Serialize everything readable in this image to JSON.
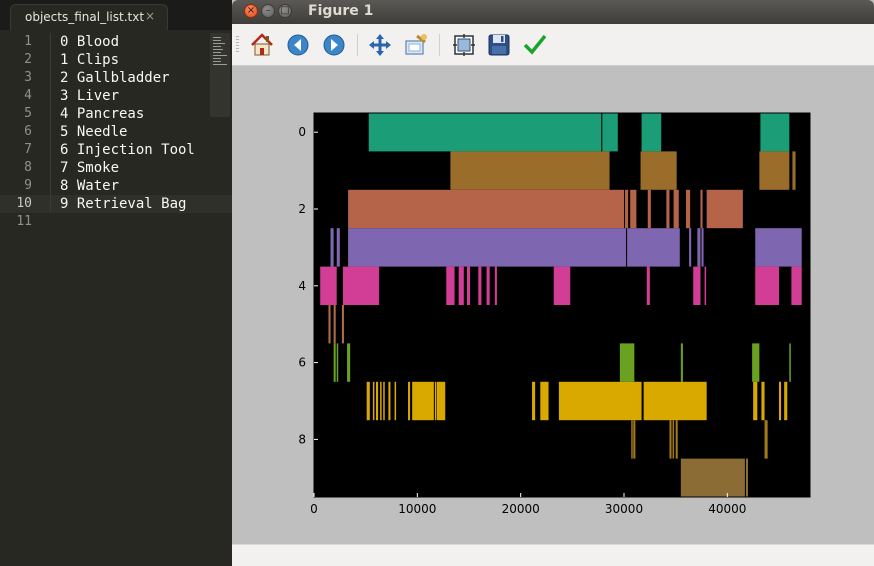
{
  "editor": {
    "tab_title": "objects_final_list.txt",
    "tab_close": "×",
    "current_line": 10,
    "lines": [
      {
        "n": "1",
        "text": "0 Blood"
      },
      {
        "n": "2",
        "text": "1 Clips"
      },
      {
        "n": "3",
        "text": "2 Gallbladder"
      },
      {
        "n": "4",
        "text": "3 Liver"
      },
      {
        "n": "5",
        "text": "4 Pancreas"
      },
      {
        "n": "6",
        "text": "5 Needle"
      },
      {
        "n": "7",
        "text": "6 Injection Tool"
      },
      {
        "n": "8",
        "text": "7 Smoke"
      },
      {
        "n": "9",
        "text": "8 Water"
      },
      {
        "n": "10",
        "text": "9 Retrieval Bag"
      },
      {
        "n": "11",
        "text": ""
      }
    ]
  },
  "window": {
    "title": "Figure 1",
    "close_glyph": "×",
    "min_glyph": "–",
    "max_glyph": "□"
  },
  "toolbar": {
    "items": [
      {
        "name": "home-button",
        "icon": "home-icon"
      },
      {
        "name": "back-button",
        "icon": "arrow-left-icon"
      },
      {
        "name": "forward-button",
        "icon": "arrow-right-icon"
      },
      {
        "name": "pan-button",
        "icon": "move-arrows-icon"
      },
      {
        "name": "zoom-button",
        "icon": "zoom-rect-icon"
      },
      {
        "name": "subplots-button",
        "icon": "subplots-icon"
      },
      {
        "name": "save-button",
        "icon": "floppy-disk-icon"
      },
      {
        "name": "edit-axes-button",
        "icon": "checkmark-icon"
      }
    ]
  },
  "statusbar": {
    "text": ""
  },
  "colors": {
    "editor_bg": "#272822",
    "plot_bg": "#000000",
    "figure_bg": "#bfbfbf"
  },
  "chart_data": {
    "type": "broken_barh",
    "xlim": [
      0,
      48000
    ],
    "ylim": [
      -0.5,
      9.5
    ],
    "y_inverted": true,
    "x_ticks": [
      0,
      10000,
      20000,
      30000,
      40000
    ],
    "x_tick_labels": [
      "0",
      "10000",
      "20000",
      "30000",
      "40000"
    ],
    "y_ticks": [
      0,
      2,
      4,
      6,
      8
    ],
    "y_tick_labels": [
      "0",
      "2",
      "4",
      "6",
      "8"
    ],
    "rows": [
      {
        "class": 0,
        "color": "#1b9e77",
        "segments": [
          [
            5300,
            27800
          ],
          [
            27900,
            29400
          ],
          [
            31700,
            33600
          ],
          [
            43200,
            46000
          ]
        ]
      },
      {
        "class": 1,
        "color": "#9a6e2a",
        "segments": [
          [
            13200,
            28600
          ],
          [
            31600,
            35100
          ],
          [
            43100,
            46000
          ],
          [
            46300,
            46600
          ]
        ]
      },
      {
        "class": 2,
        "color": "#b5644a",
        "segments": [
          [
            3300,
            30000
          ],
          [
            30100,
            30400
          ],
          [
            30600,
            31200
          ],
          [
            32300,
            32600
          ],
          [
            34100,
            34400
          ],
          [
            34800,
            35300
          ],
          [
            36000,
            36400
          ],
          [
            37400,
            37600
          ],
          [
            38000,
            41500
          ]
        ]
      },
      {
        "class": 3,
        "color": "#7e66b0",
        "segments": [
          [
            1600,
            1900
          ],
          [
            2200,
            2500
          ],
          [
            3300,
            30200
          ],
          [
            30300,
            35400
          ],
          [
            36300,
            36500
          ],
          [
            37100,
            37400
          ],
          [
            37500,
            37700
          ],
          [
            42700,
            47200
          ]
        ]
      },
      {
        "class": 4,
        "color": "#d23d95",
        "segments": [
          [
            600,
            2200
          ],
          [
            2800,
            6300
          ],
          [
            12800,
            13600
          ],
          [
            14000,
            14500
          ],
          [
            14800,
            15100
          ],
          [
            15900,
            16200
          ],
          [
            16700,
            17000
          ],
          [
            17500,
            17700
          ],
          [
            23200,
            24800
          ],
          [
            32200,
            32500
          ],
          [
            36700,
            37400
          ],
          [
            37800,
            37900
          ],
          [
            42700,
            45000
          ],
          [
            46200,
            47200
          ]
        ]
      },
      {
        "class": 5,
        "color": "#b06a4c",
        "segments": [
          [
            1400,
            1600
          ],
          [
            1900,
            2100
          ],
          [
            2700,
            2900
          ]
        ]
      },
      {
        "class": 6,
        "color": "#6aa121",
        "segments": [
          [
            1900,
            2100
          ],
          [
            2200,
            2300
          ],
          [
            3200,
            3500
          ],
          [
            29600,
            31000
          ],
          [
            35500,
            35700
          ],
          [
            42400,
            43100
          ],
          [
            46000,
            46100
          ]
        ]
      },
      {
        "class": 7,
        "color": "#d9a900",
        "segments": [
          [
            5100,
            5400
          ],
          [
            5700,
            5800
          ],
          [
            6000,
            6200
          ],
          [
            6400,
            6500
          ],
          [
            6700,
            6800
          ],
          [
            7200,
            7400
          ],
          [
            7800,
            7900
          ],
          [
            9100,
            9300
          ],
          [
            9500,
            11600
          ],
          [
            11700,
            11800
          ],
          [
            11900,
            12700
          ],
          [
            21100,
            21400
          ],
          [
            21900,
            22700
          ],
          [
            23700,
            31700
          ],
          [
            31900,
            38000
          ],
          [
            42500,
            42900
          ],
          [
            43300,
            43600
          ],
          [
            45000,
            45200
          ],
          [
            45500,
            45800
          ]
        ]
      },
      {
        "class": 8,
        "color": "#a2791c",
        "segments": [
          [
            30700,
            30800
          ],
          [
            30900,
            31100
          ],
          [
            34400,
            34600
          ],
          [
            34700,
            34800
          ],
          [
            35000,
            35200
          ],
          [
            43600,
            43900
          ]
        ]
      },
      {
        "class": 9,
        "color": "#8a6c34",
        "segments": [
          [
            35500,
            41700
          ],
          [
            41800,
            42000
          ]
        ]
      }
    ]
  }
}
